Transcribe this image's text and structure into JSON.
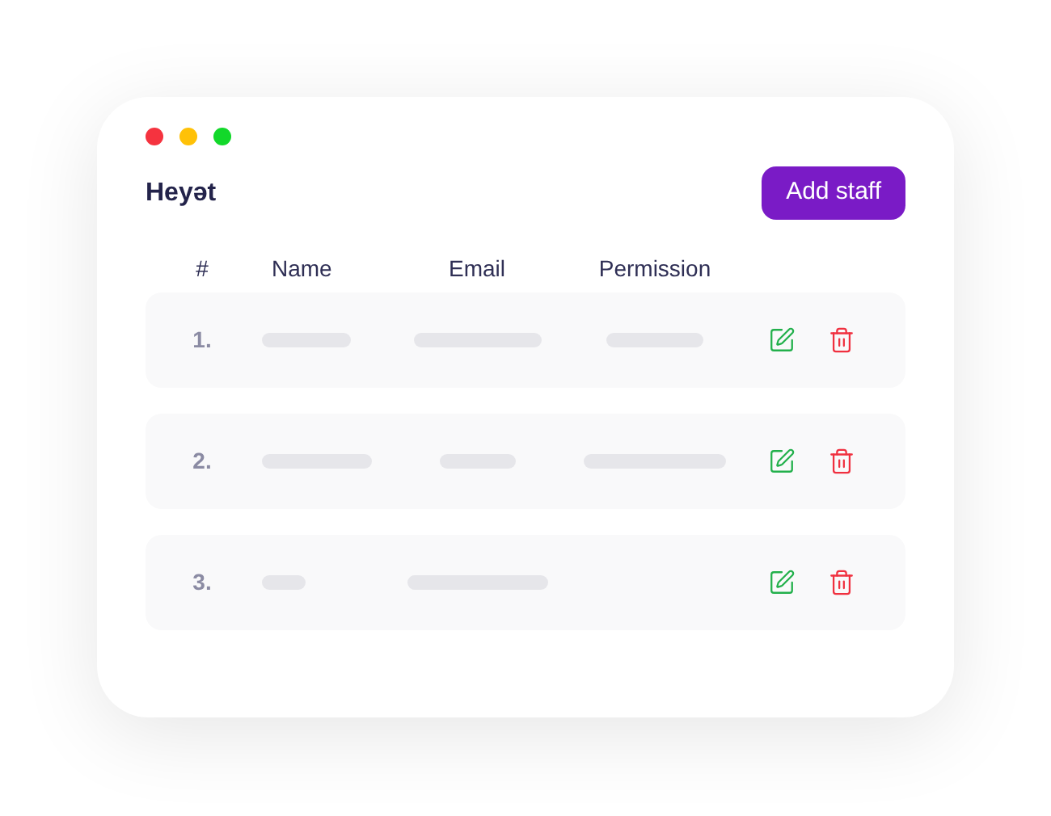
{
  "window": {
    "controls": [
      {
        "color": "#f5333f"
      },
      {
        "color": "#ffc107"
      },
      {
        "color": "#12d82a"
      }
    ]
  },
  "title": "Heyət",
  "add_button": "Add staff",
  "table": {
    "columns": [
      "#",
      "Name",
      "Email",
      "Permission"
    ],
    "rows": [
      {
        "number": "1.",
        "cells": [
          {
            "kind": "skeleton"
          },
          {
            "kind": "skeleton"
          },
          {
            "kind": "skeleton"
          }
        ]
      },
      {
        "number": "2.",
        "cells": [
          {
            "kind": "skeleton"
          },
          {
            "kind": "skeleton"
          },
          {
            "kind": "skeleton"
          }
        ]
      },
      {
        "number": "3.",
        "cells": [
          {
            "kind": "skeleton"
          },
          {
            "kind": "skeleton"
          },
          {
            "kind": "empty"
          }
        ]
      }
    ]
  }
}
